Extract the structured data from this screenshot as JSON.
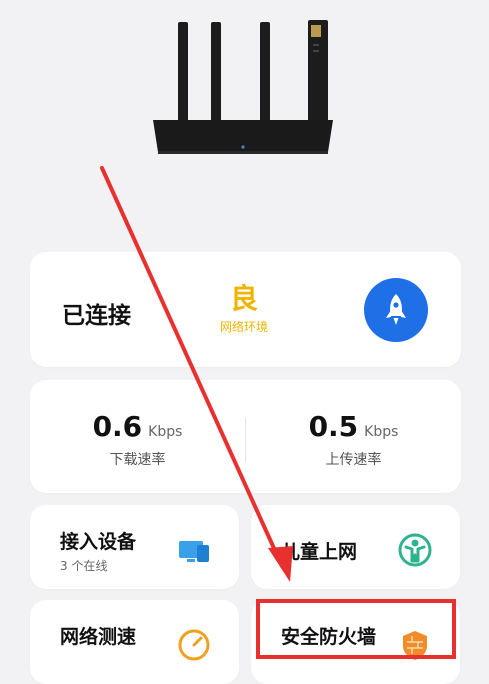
{
  "status": {
    "connection": "已连接",
    "quality_grade": "良",
    "quality_label": "网络环境"
  },
  "speed": {
    "download": {
      "value": "0.6",
      "unit": "Kbps",
      "label": "下载速率"
    },
    "upload": {
      "value": "0.5",
      "unit": "Kbps",
      "label": "上传速率"
    }
  },
  "tiles": [
    {
      "title": "接入设备",
      "subtitle": "3 个在线",
      "icon": "devices-icon"
    },
    {
      "title": "儿童上网",
      "icon": "child-icon"
    },
    {
      "title": "网络测速",
      "icon": "speedometer-icon"
    },
    {
      "title": "安全防火墙",
      "icon": "firewall-icon"
    }
  ],
  "colors": {
    "accent_blue": "#1f6fe6",
    "grade_yellow": "#f0b400",
    "annotation_red": "#e8312f"
  }
}
